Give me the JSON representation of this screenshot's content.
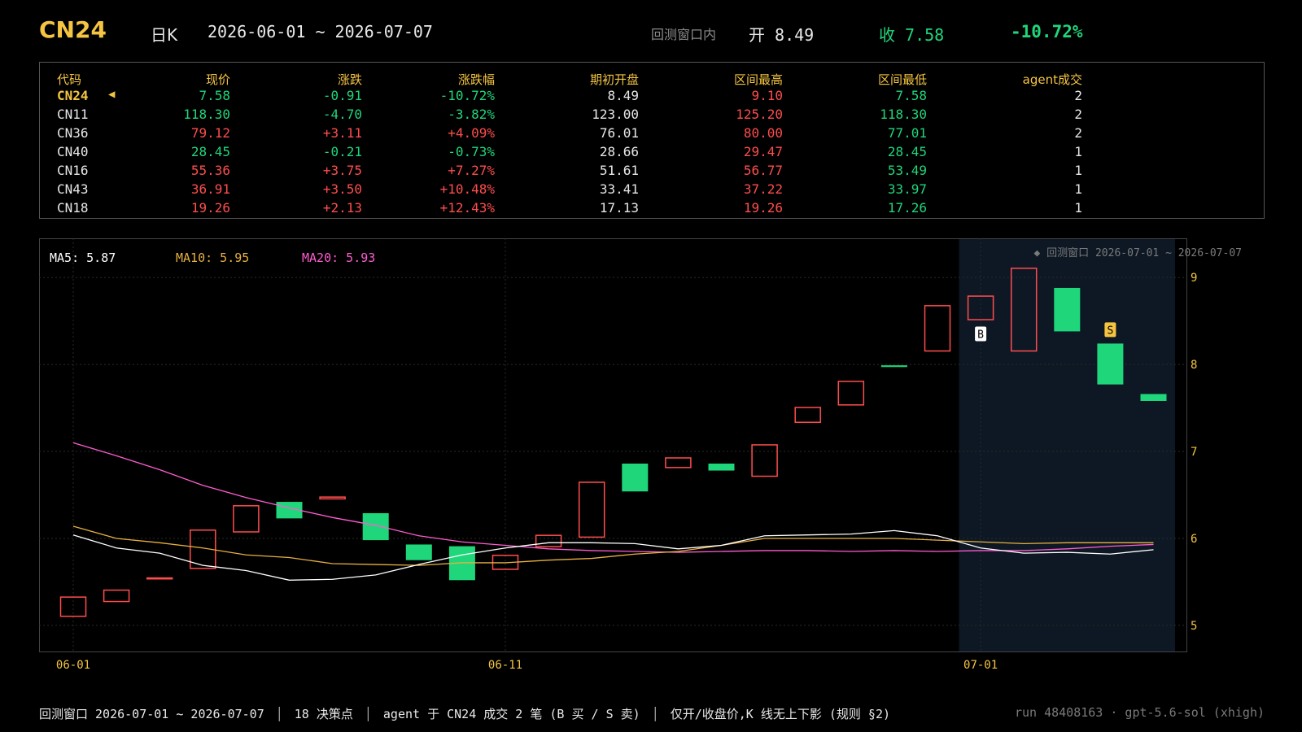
{
  "header": {
    "symbol": "CN24",
    "period": "日K",
    "date_range": "2026-06-01 ~ 2026-07-07",
    "window_label": "回测窗口内",
    "open_text": "开 8.49",
    "close_text": "收 7.58",
    "change_pct": "-10.72%"
  },
  "table": {
    "headers": [
      "代码",
      "现价",
      "涨跌",
      "涨跌幅",
      "期初开盘",
      "区间最高",
      "区间最低",
      "agent成交"
    ],
    "current_marker": "◀",
    "rows": [
      {
        "code": "CN24",
        "price": "7.58",
        "chg": "-0.91",
        "pct": "-10.72%",
        "open": "8.49",
        "high": "9.10",
        "low": "7.58",
        "trades": "2",
        "dir": "dn",
        "current": true
      },
      {
        "code": "CN11",
        "price": "118.30",
        "chg": "-4.70",
        "pct": "-3.82%",
        "open": "123.00",
        "high": "125.20",
        "low": "118.30",
        "trades": "2",
        "dir": "dn"
      },
      {
        "code": "CN36",
        "price": "79.12",
        "chg": "+3.11",
        "pct": "+4.09%",
        "open": "76.01",
        "high": "80.00",
        "low": "77.01",
        "trades": "2",
        "dir": "up"
      },
      {
        "code": "CN40",
        "price": "28.45",
        "chg": "-0.21",
        "pct": "-0.73%",
        "open": "28.66",
        "high": "29.47",
        "low": "28.45",
        "trades": "1",
        "dir": "dn"
      },
      {
        "code": "CN16",
        "price": "55.36",
        "chg": "+3.75",
        "pct": "+7.27%",
        "open": "51.61",
        "high": "56.77",
        "low": "53.49",
        "trades": "1",
        "dir": "up"
      },
      {
        "code": "CN43",
        "price": "36.91",
        "chg": "+3.50",
        "pct": "+10.48%",
        "open": "33.41",
        "high": "37.22",
        "low": "33.97",
        "trades": "1",
        "dir": "up"
      },
      {
        "code": "CN18",
        "price": "19.26",
        "chg": "+2.13",
        "pct": "+12.43%",
        "open": "17.13",
        "high": "19.26",
        "low": "17.26",
        "trades": "1",
        "dir": "up"
      }
    ]
  },
  "chart": {
    "ma_labels": {
      "ma5": "MA5: 5.87",
      "ma10": "MA10: 5.95",
      "ma20": "MA20: 5.93"
    },
    "window_annotation": "◆ 回测窗口 2026-07-01 ~ 2026-07-07",
    "buy_marker": "B",
    "sell_marker": "S",
    "colors": {
      "up": "#ff4d4d",
      "down": "#1fd67a",
      "ma5": "#ffffff",
      "ma10": "#e8b040",
      "ma20": "#ff5cd0",
      "axis": "#f5c542",
      "window_bg": "#0d1824"
    }
  },
  "chart_data": {
    "type": "candlestick",
    "x_ticks": [
      "06-01",
      "06-11",
      "07-01"
    ],
    "y_ticks": [
      "5",
      "6",
      "7",
      "8",
      "9"
    ],
    "ylim": [
      4.7,
      9.45
    ],
    "window_start_index": 21,
    "candles": [
      {
        "open": 5.1,
        "close": 5.33
      },
      {
        "open": 5.27,
        "close": 5.41
      },
      {
        "open": 5.53,
        "close": 5.55
      },
      {
        "open": 5.65,
        "close": 6.1
      },
      {
        "open": 6.07,
        "close": 6.38
      },
      {
        "open": 6.42,
        "close": 6.23
      },
      {
        "open": 6.45,
        "close": 6.48
      },
      {
        "open": 6.29,
        "close": 5.98
      },
      {
        "open": 5.93,
        "close": 5.75
      },
      {
        "open": 5.91,
        "close": 5.52
      },
      {
        "open": 5.64,
        "close": 5.81
      },
      {
        "open": 5.9,
        "close": 6.04
      },
      {
        "open": 6.01,
        "close": 6.65
      },
      {
        "open": 6.86,
        "close": 6.54
      },
      {
        "open": 6.81,
        "close": 6.93
      },
      {
        "open": 6.86,
        "close": 6.78
      },
      {
        "open": 6.71,
        "close": 7.08
      },
      {
        "open": 7.33,
        "close": 7.51
      },
      {
        "open": 7.53,
        "close": 7.81
      },
      {
        "open": 7.99,
        "close": 7.97
      },
      {
        "open": 8.15,
        "close": 8.68
      },
      {
        "open": 8.51,
        "close": 8.79
      },
      {
        "open": 8.15,
        "close": 9.11
      },
      {
        "open": 8.88,
        "close": 8.38
      },
      {
        "open": 8.24,
        "close": 7.77
      },
      {
        "open": 7.66,
        "close": 7.58
      }
    ],
    "ma5": [
      6.04,
      5.89,
      5.83,
      5.69,
      5.63,
      5.52,
      5.53,
      5.58,
      5.7,
      5.81,
      5.89,
      5.95,
      5.95,
      5.94,
      5.88,
      5.92,
      6.03,
      6.04,
      6.05,
      6.09,
      6.03,
      5.89,
      5.83,
      5.84,
      5.82,
      5.87
    ],
    "ma10": [
      6.14,
      6.0,
      5.95,
      5.89,
      5.81,
      5.78,
      5.71,
      5.7,
      5.69,
      5.72,
      5.72,
      5.75,
      5.77,
      5.82,
      5.85,
      5.92,
      6.0,
      6.0,
      6.0,
      6.0,
      5.98,
      5.96,
      5.94,
      5.95,
      5.95,
      5.95
    ],
    "ma20": [
      7.1,
      6.95,
      6.79,
      6.61,
      6.47,
      6.35,
      6.24,
      6.15,
      6.03,
      5.96,
      5.92,
      5.88,
      5.86,
      5.85,
      5.84,
      5.85,
      5.86,
      5.86,
      5.85,
      5.86,
      5.85,
      5.86,
      5.86,
      5.88,
      5.91,
      5.93
    ],
    "markers": [
      {
        "type": "B",
        "index": 21
      },
      {
        "type": "S",
        "index": 24
      }
    ]
  },
  "footer": {
    "window": "回测窗口 2026-07-01 ~ 2026-07-07",
    "decisions": "18 决策点",
    "trades": "agent 于 CN24 成交 2 笔 (B 买 / S 卖)",
    "rule": "仅开/收盘价,K 线无上下影 (规则 §2)",
    "run": "run 48408163 · gpt-5.6-sol (xhigh)"
  }
}
